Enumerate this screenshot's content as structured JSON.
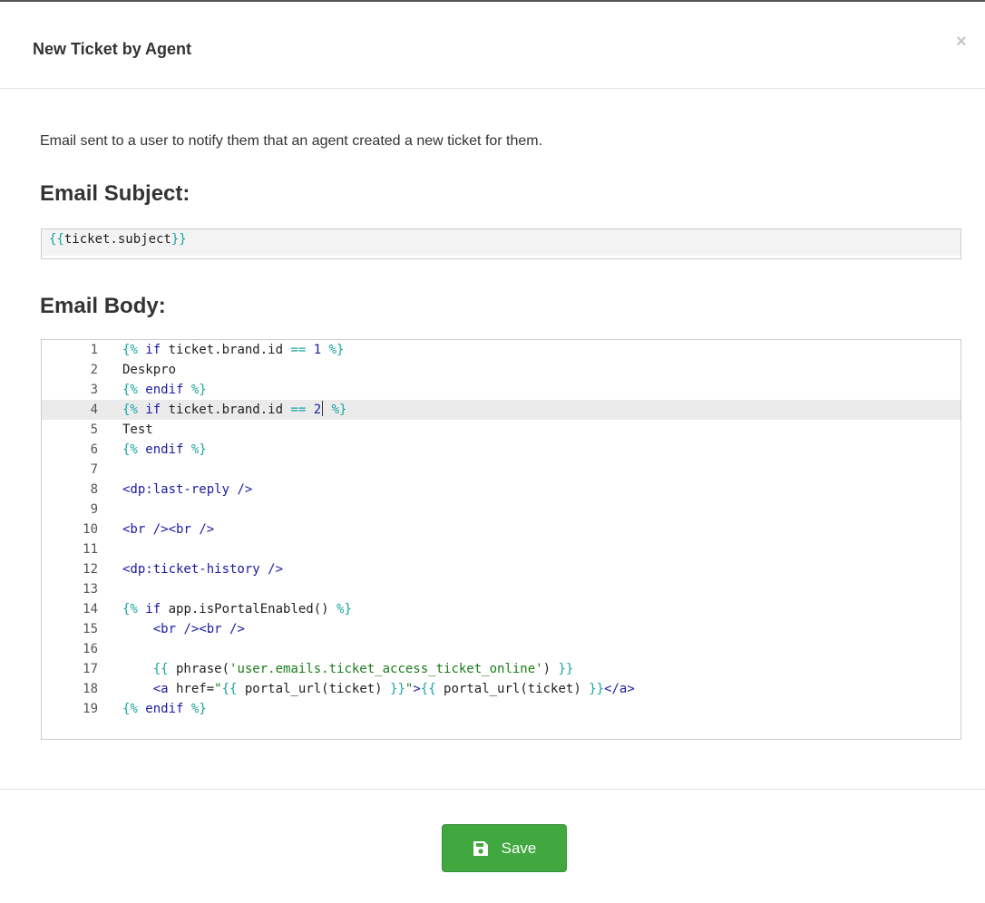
{
  "modal": {
    "title": "New Ticket by Agent",
    "close_label": "×",
    "description": "Email sent to a user to notify them that an agent created a new ticket for them."
  },
  "subject": {
    "heading": "Email Subject:",
    "value": "{{ticket.subject}}"
  },
  "body": {
    "heading": "Email Body:",
    "active_line": 4,
    "lines": [
      {
        "n": "1",
        "text": "{% if ticket.brand.id == 1 %}"
      },
      {
        "n": "2",
        "text": "Deskpro"
      },
      {
        "n": "3",
        "text": "{% endif %}"
      },
      {
        "n": "4",
        "text": "{% if ticket.brand.id == 2 %}"
      },
      {
        "n": "5",
        "text": "Test"
      },
      {
        "n": "6",
        "text": "{% endif %}"
      },
      {
        "n": "7",
        "text": ""
      },
      {
        "n": "8",
        "text": "<dp:last-reply />"
      },
      {
        "n": "9",
        "text": ""
      },
      {
        "n": "10",
        "text": "<br /><br />"
      },
      {
        "n": "11",
        "text": ""
      },
      {
        "n": "12",
        "text": "<dp:ticket-history />"
      },
      {
        "n": "13",
        "text": ""
      },
      {
        "n": "14",
        "text": "{% if app.isPortalEnabled() %}"
      },
      {
        "n": "15",
        "text": "    <br /><br />"
      },
      {
        "n": "16",
        "text": ""
      },
      {
        "n": "17",
        "text": "    {{ phrase('user.emails.ticket_access_ticket_online') }}"
      },
      {
        "n": "18",
        "text": "    <a href=\"{{ portal_url(ticket) }}\">{{ portal_url(ticket) }}</a>"
      },
      {
        "n": "19",
        "text": "{% endif %}"
      }
    ]
  },
  "footer": {
    "save_label": "Save",
    "save_icon": "floppy-disk-icon",
    "save_color": "#40a83f"
  }
}
